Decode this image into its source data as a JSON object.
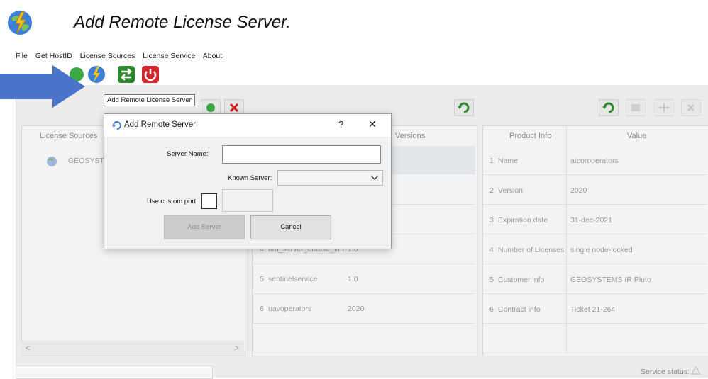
{
  "caption": {
    "text": "Add Remote License Server."
  },
  "menu": [
    "File",
    "Get HostID",
    "License Sources",
    "License Service",
    "About"
  ],
  "tooltip": "Add Remote License Server",
  "left_panel": {
    "header": "License Sources",
    "item": "GEOSYSTE"
  },
  "middle_panel": {
    "header_versions": "Versions",
    "rows": [
      {
        "num": "4",
        "name": "nm_server_enable_vm",
        "ver": "1.0"
      },
      {
        "num": "5",
        "name": "sentinelservice",
        "ver": "1.0"
      },
      {
        "num": "6",
        "name": "uavoperators",
        "ver": "2020"
      }
    ]
  },
  "right_panel": {
    "headers": [
      "Product Info",
      "Value"
    ],
    "rows": [
      {
        "num": "1",
        "key": "Name",
        "val": "atcoroperators"
      },
      {
        "num": "2",
        "key": "Version",
        "val": "2020"
      },
      {
        "num": "3",
        "key": "Expiration date",
        "val": "31-dec-2021"
      },
      {
        "num": "4",
        "key": "Number of Licenses",
        "val": "single node-locked"
      },
      {
        "num": "5",
        "key": "Customer info",
        "val": "GEOSYSTEMS IR Pluto"
      },
      {
        "num": "6",
        "key": "Contract info",
        "val": "Ticket 21-264"
      }
    ]
  },
  "dialog": {
    "title": "Add Remote Server",
    "help": "?",
    "close": "✕",
    "server_name_label": "Server Name:",
    "server_name_value": "",
    "known_server_label": "Known Server:",
    "known_server_value": "",
    "custom_port_label": "Use custom port",
    "add_button": "Add Server",
    "cancel_button": "Cancel"
  },
  "status": {
    "label": "Service status:"
  },
  "colors": {
    "arrow": "#4a74c9",
    "accent_green": "#2e8b2e",
    "power_red": "#d9262b"
  }
}
